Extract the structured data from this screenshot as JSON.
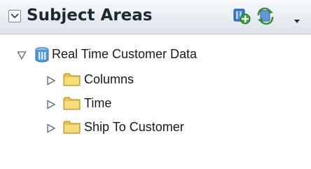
{
  "panel": {
    "title": "Subject Areas",
    "icons": [
      "collapse-icon",
      "add-subject-area-icon",
      "refresh-icon",
      "dropdown-arrow-icon"
    ]
  },
  "tree": {
    "root": {
      "label": "Real Time Customer Data",
      "icon": "subject-area-icon",
      "expanded": true
    },
    "children": [
      {
        "label": "Columns",
        "icon": "folder-icon",
        "expanded": false
      },
      {
        "label": "Time",
        "icon": "folder-icon",
        "expanded": false
      },
      {
        "label": "Ship To Customer",
        "icon": "folder-icon",
        "expanded": false
      }
    ]
  }
}
